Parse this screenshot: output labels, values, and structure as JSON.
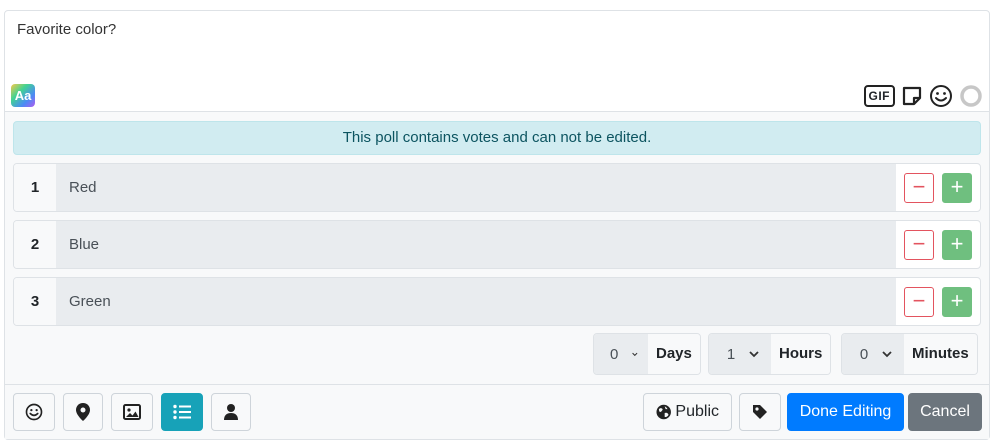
{
  "composer": {
    "text": "Favorite color?",
    "format_icon_label": "Aa",
    "gif_label": "GIF"
  },
  "poll": {
    "alert": "This poll contains votes and can not be edited.",
    "options": [
      {
        "number": "1",
        "value": "Red"
      },
      {
        "number": "2",
        "value": "Blue"
      },
      {
        "number": "3",
        "value": "Green"
      }
    ],
    "remove_symbol": "−",
    "add_symbol": "+",
    "duration": {
      "days": {
        "value": "0",
        "label": "Days"
      },
      "hours": {
        "value": "1",
        "label": "Hours"
      },
      "minutes": {
        "value": "0",
        "label": "Minutes"
      }
    }
  },
  "footer": {
    "visibility_label": "Public",
    "done_label": "Done Editing",
    "cancel_label": "Cancel"
  },
  "colors": {
    "primary": "#007bff",
    "info": "#17a2b8",
    "danger": "#e3545f",
    "success": "#6fbf7f",
    "secondary": "#6c757d",
    "alert_bg": "#d1ecf1"
  }
}
